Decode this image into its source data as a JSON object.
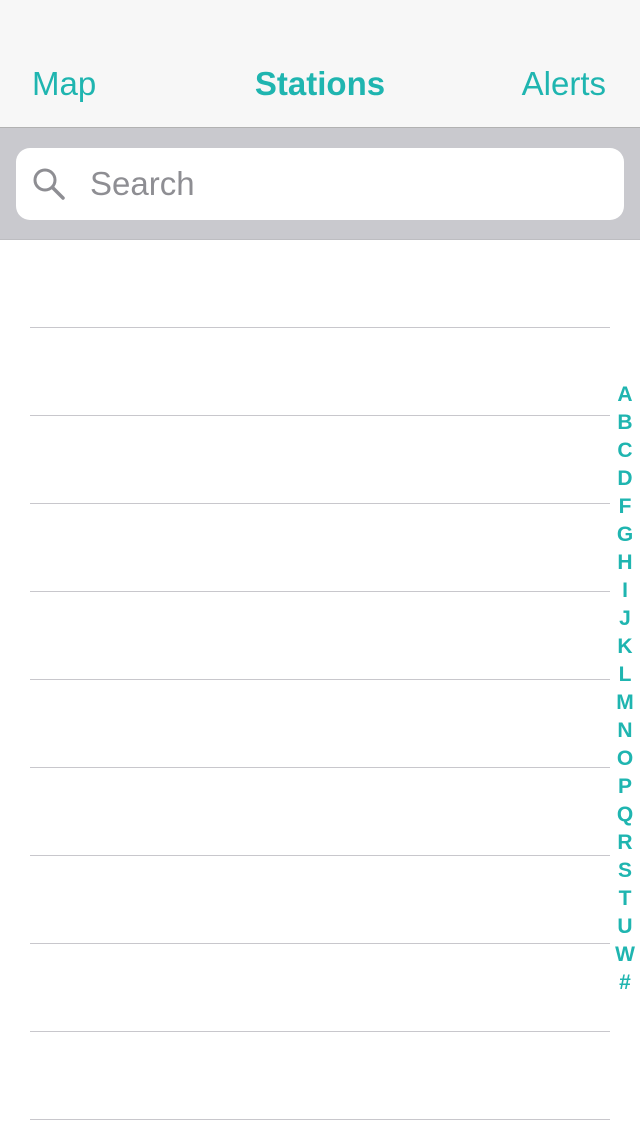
{
  "navbar": {
    "left_label": "Map",
    "title": "Stations",
    "right_label": "Alerts"
  },
  "search": {
    "placeholder": "Search",
    "value": ""
  },
  "list": {
    "row_count": 10
  },
  "index": [
    "A",
    "B",
    "C",
    "D",
    "F",
    "G",
    "H",
    "I",
    "J",
    "K",
    "L",
    "M",
    "N",
    "O",
    "P",
    "Q",
    "R",
    "S",
    "T",
    "U",
    "W",
    "#"
  ],
  "colors": {
    "accent": "#1fb5b0",
    "navbar_bg": "#f7f7f7",
    "search_bar_bg": "#c9c9ce",
    "separator": "#c8c7cc"
  }
}
